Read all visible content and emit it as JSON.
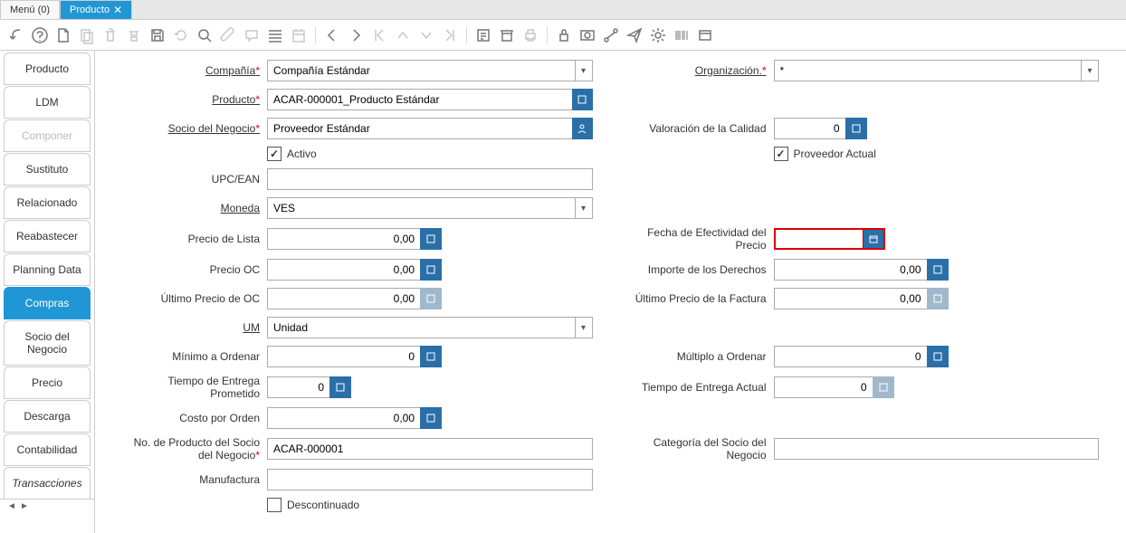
{
  "tabs": {
    "menu": "Menú (0)",
    "producto": "Producto"
  },
  "sidebar": {
    "items": [
      "Producto",
      "LDM",
      "Componer",
      "Sustituto",
      "Relacionado",
      "Reabastecer",
      "Planning Data",
      "Compras",
      "Socio del Negocio",
      "Precio",
      "Descarga",
      "Contabilidad",
      "Transacciones"
    ]
  },
  "labels": {
    "compania": "Compañía",
    "organizacion": "Organización.",
    "producto": "Producto",
    "socio_negocio": "Socio del Negocio",
    "valoracion": "Valoración de la Calidad",
    "activo": "Activo",
    "proveedor_actual": "Proveedor Actual",
    "upc": "UPC/EAN",
    "moneda": "Moneda",
    "precio_lista": "Precio de Lista",
    "fecha_efectividad": "Fecha de Efectividad del Precio",
    "precio_oc": "Precio OC",
    "importe_derechos": "Importe de los Derechos",
    "ultimo_precio_oc": "Último Precio de OC",
    "ultimo_precio_factura": "Último Precio de la Factura",
    "um": "UM",
    "minimo_ordenar": "Mínimo a Ordenar",
    "multiplo_ordenar": "Múltiplo a Ordenar",
    "tiempo_prometido": "Tiempo de Entrega Prometido",
    "tiempo_actual": "Tiempo de Entrega Actual",
    "costo_orden": "Costo por Orden",
    "no_producto_socio": "No. de Producto del Socio del Negocio",
    "categoria_socio": "Categoría del Socio del Negocio",
    "manufactura": "Manufactura",
    "descontinuado": "Descontinuado"
  },
  "values": {
    "compania": "Compañía Estándar",
    "organizacion": "*",
    "producto": "ACAR-000001_Producto Estándar",
    "socio_negocio": "Proveedor Estándar",
    "valoracion": "0",
    "activo": true,
    "proveedor_actual": true,
    "upc": "",
    "moneda": "VES",
    "precio_lista": "0,00",
    "fecha_efectividad": "",
    "precio_oc": "0,00",
    "importe_derechos": "0,00",
    "ultimo_precio_oc": "0,00",
    "ultimo_precio_factura": "0,00",
    "um": "Unidad",
    "minimo_ordenar": "0",
    "multiplo_ordenar": "0",
    "tiempo_prometido": "0",
    "tiempo_actual": "0",
    "costo_orden": "0,00",
    "no_producto_socio": "ACAR-000001",
    "categoria_socio": "",
    "manufactura": "",
    "descontinuado": false
  }
}
